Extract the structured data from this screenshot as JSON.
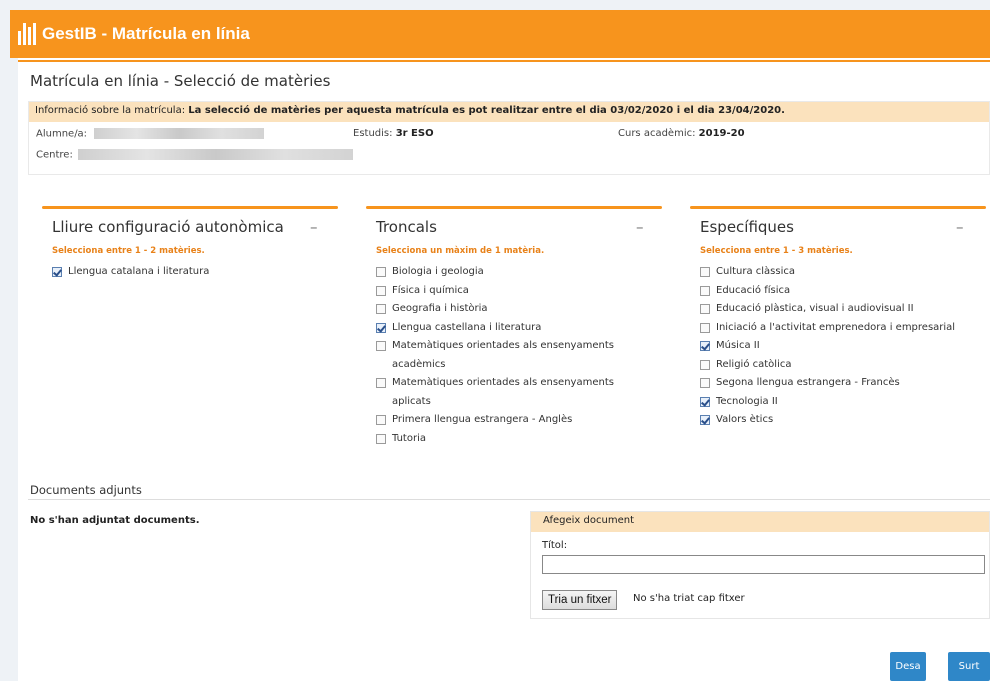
{
  "app": {
    "title": "GestIB - Matrícula en línia"
  },
  "page": {
    "title": "Matrícula en línia - Selecció de matèries"
  },
  "info": {
    "label": "Informació sobre la matrícula:",
    "message": "La selecció de matèries per aquesta matrícula es pot realitzar entre el dia 03/02/2020 i el dia 23/04/2020.",
    "student_label": "Alumne/a:",
    "studies_label": "Estudis:",
    "studies_value": "3r ESO",
    "year_label": "Curs acadèmic:",
    "year_value": "2019-20",
    "center_label": "Centre:"
  },
  "panels": [
    {
      "title": "Lliure configuració autonòmica",
      "collapse": "–",
      "hint": "Selecciona entre 1 - 2 matèries.",
      "items": [
        {
          "label": "Llengua catalana i literatura",
          "checked": true
        }
      ]
    },
    {
      "title": "Troncals",
      "collapse": "–",
      "hint": "Selecciona un màxim de 1 matèria.",
      "items": [
        {
          "label": "Biologia i geologia",
          "checked": false
        },
        {
          "label": "Física i química",
          "checked": false
        },
        {
          "label": "Geografia i història",
          "checked": false
        },
        {
          "label": "Llengua castellana i literatura",
          "checked": true
        },
        {
          "label": "Matemàtiques orientades als ensenyaments acadèmics",
          "checked": false
        },
        {
          "label": "Matemàtiques orientades als ensenyaments aplicats",
          "checked": false
        },
        {
          "label": "Primera llengua estrangera - Anglès",
          "checked": false
        },
        {
          "label": "Tutoria",
          "checked": false
        }
      ]
    },
    {
      "title": "Específiques",
      "collapse": "–",
      "hint": "Selecciona entre 1 - 3 matèries.",
      "items": [
        {
          "label": "Cultura clàssica",
          "checked": false
        },
        {
          "label": "Educació física",
          "checked": false
        },
        {
          "label": "Educació plàstica, visual i audiovisual II",
          "checked": false
        },
        {
          "label": "Iniciació a l'activitat emprenedora i empresarial",
          "checked": false
        },
        {
          "label": "Música II",
          "checked": true
        },
        {
          "label": "Religió catòlica",
          "checked": false
        },
        {
          "label": "Segona llengua estrangera - Francès",
          "checked": false
        },
        {
          "label": "Tecnologia II",
          "checked": true
        },
        {
          "label": "Valors ètics",
          "checked": true
        }
      ]
    }
  ],
  "documents": {
    "title": "Documents adjunts",
    "empty": "No s'han adjuntat documents.",
    "add_header": "Afegeix document",
    "title_label": "Títol:",
    "title_value": "",
    "file_button": "Tria un fitxer",
    "file_status": "No s'ha triat cap fitxer"
  },
  "actions": {
    "save": "Desa",
    "exit": "Surt"
  },
  "colors": {
    "accent": "#f7941d",
    "info_bg": "#fbe2bd",
    "button": "#2f87c8"
  }
}
